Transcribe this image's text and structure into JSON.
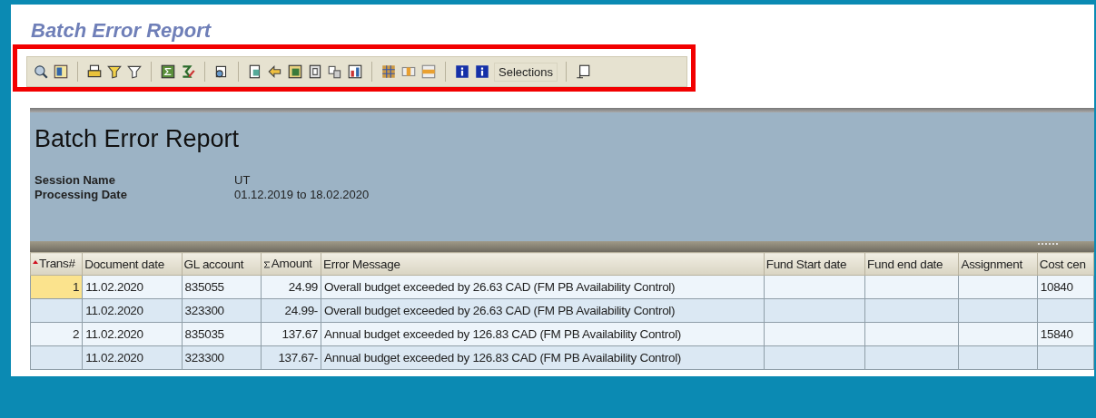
{
  "window": {
    "title": "Batch Error Report"
  },
  "toolbar": {
    "text_button": "Selections"
  },
  "header": {
    "title": "Batch Error Report",
    "fields": [
      {
        "label": "Session Name",
        "value": "UT"
      },
      {
        "label": "Processing Date",
        "value": "01.12.2019 to 18.02.2020"
      }
    ]
  },
  "table": {
    "columns": [
      {
        "label": "Trans#",
        "sorted": true,
        "summed": false
      },
      {
        "label": "Document date",
        "sorted": false,
        "summed": false
      },
      {
        "label": "GL account",
        "sorted": false,
        "summed": false
      },
      {
        "label": "Amount",
        "sorted": false,
        "summed": true
      },
      {
        "label": "Error Message",
        "sorted": false,
        "summed": false
      },
      {
        "label": "Fund Start date",
        "sorted": false,
        "summed": false
      },
      {
        "label": "Fund end date",
        "sorted": false,
        "summed": false
      },
      {
        "label": "Assignment",
        "sorted": false,
        "summed": false
      },
      {
        "label": "Cost cen",
        "sorted": false,
        "summed": false
      }
    ],
    "rows": [
      {
        "selected": true,
        "cells": [
          "1",
          "11.02.2020",
          "835055",
          "24.99",
          "Overall budget exceeded by 26.63 CAD (FM PB Availability Control)",
          "",
          "",
          "",
          "10840"
        ]
      },
      {
        "selected": false,
        "cells": [
          "",
          "11.02.2020",
          "323300",
          "24.99-",
          "Overall budget exceeded by 26.63 CAD (FM PB Availability Control)",
          "",
          "",
          "",
          ""
        ]
      },
      {
        "selected": false,
        "cells": [
          "2",
          "11.02.2020",
          "835035",
          "137.67",
          "Annual budget exceeded by 126.83 CAD (FM PB Availability Control)",
          "",
          "",
          "",
          "15840"
        ]
      },
      {
        "selected": false,
        "cells": [
          "",
          "11.02.2020",
          "323300",
          "137.67-",
          "Annual budget exceeded by 126.83 CAD (FM PB Availability Control)",
          "",
          "",
          "",
          ""
        ]
      }
    ]
  }
}
